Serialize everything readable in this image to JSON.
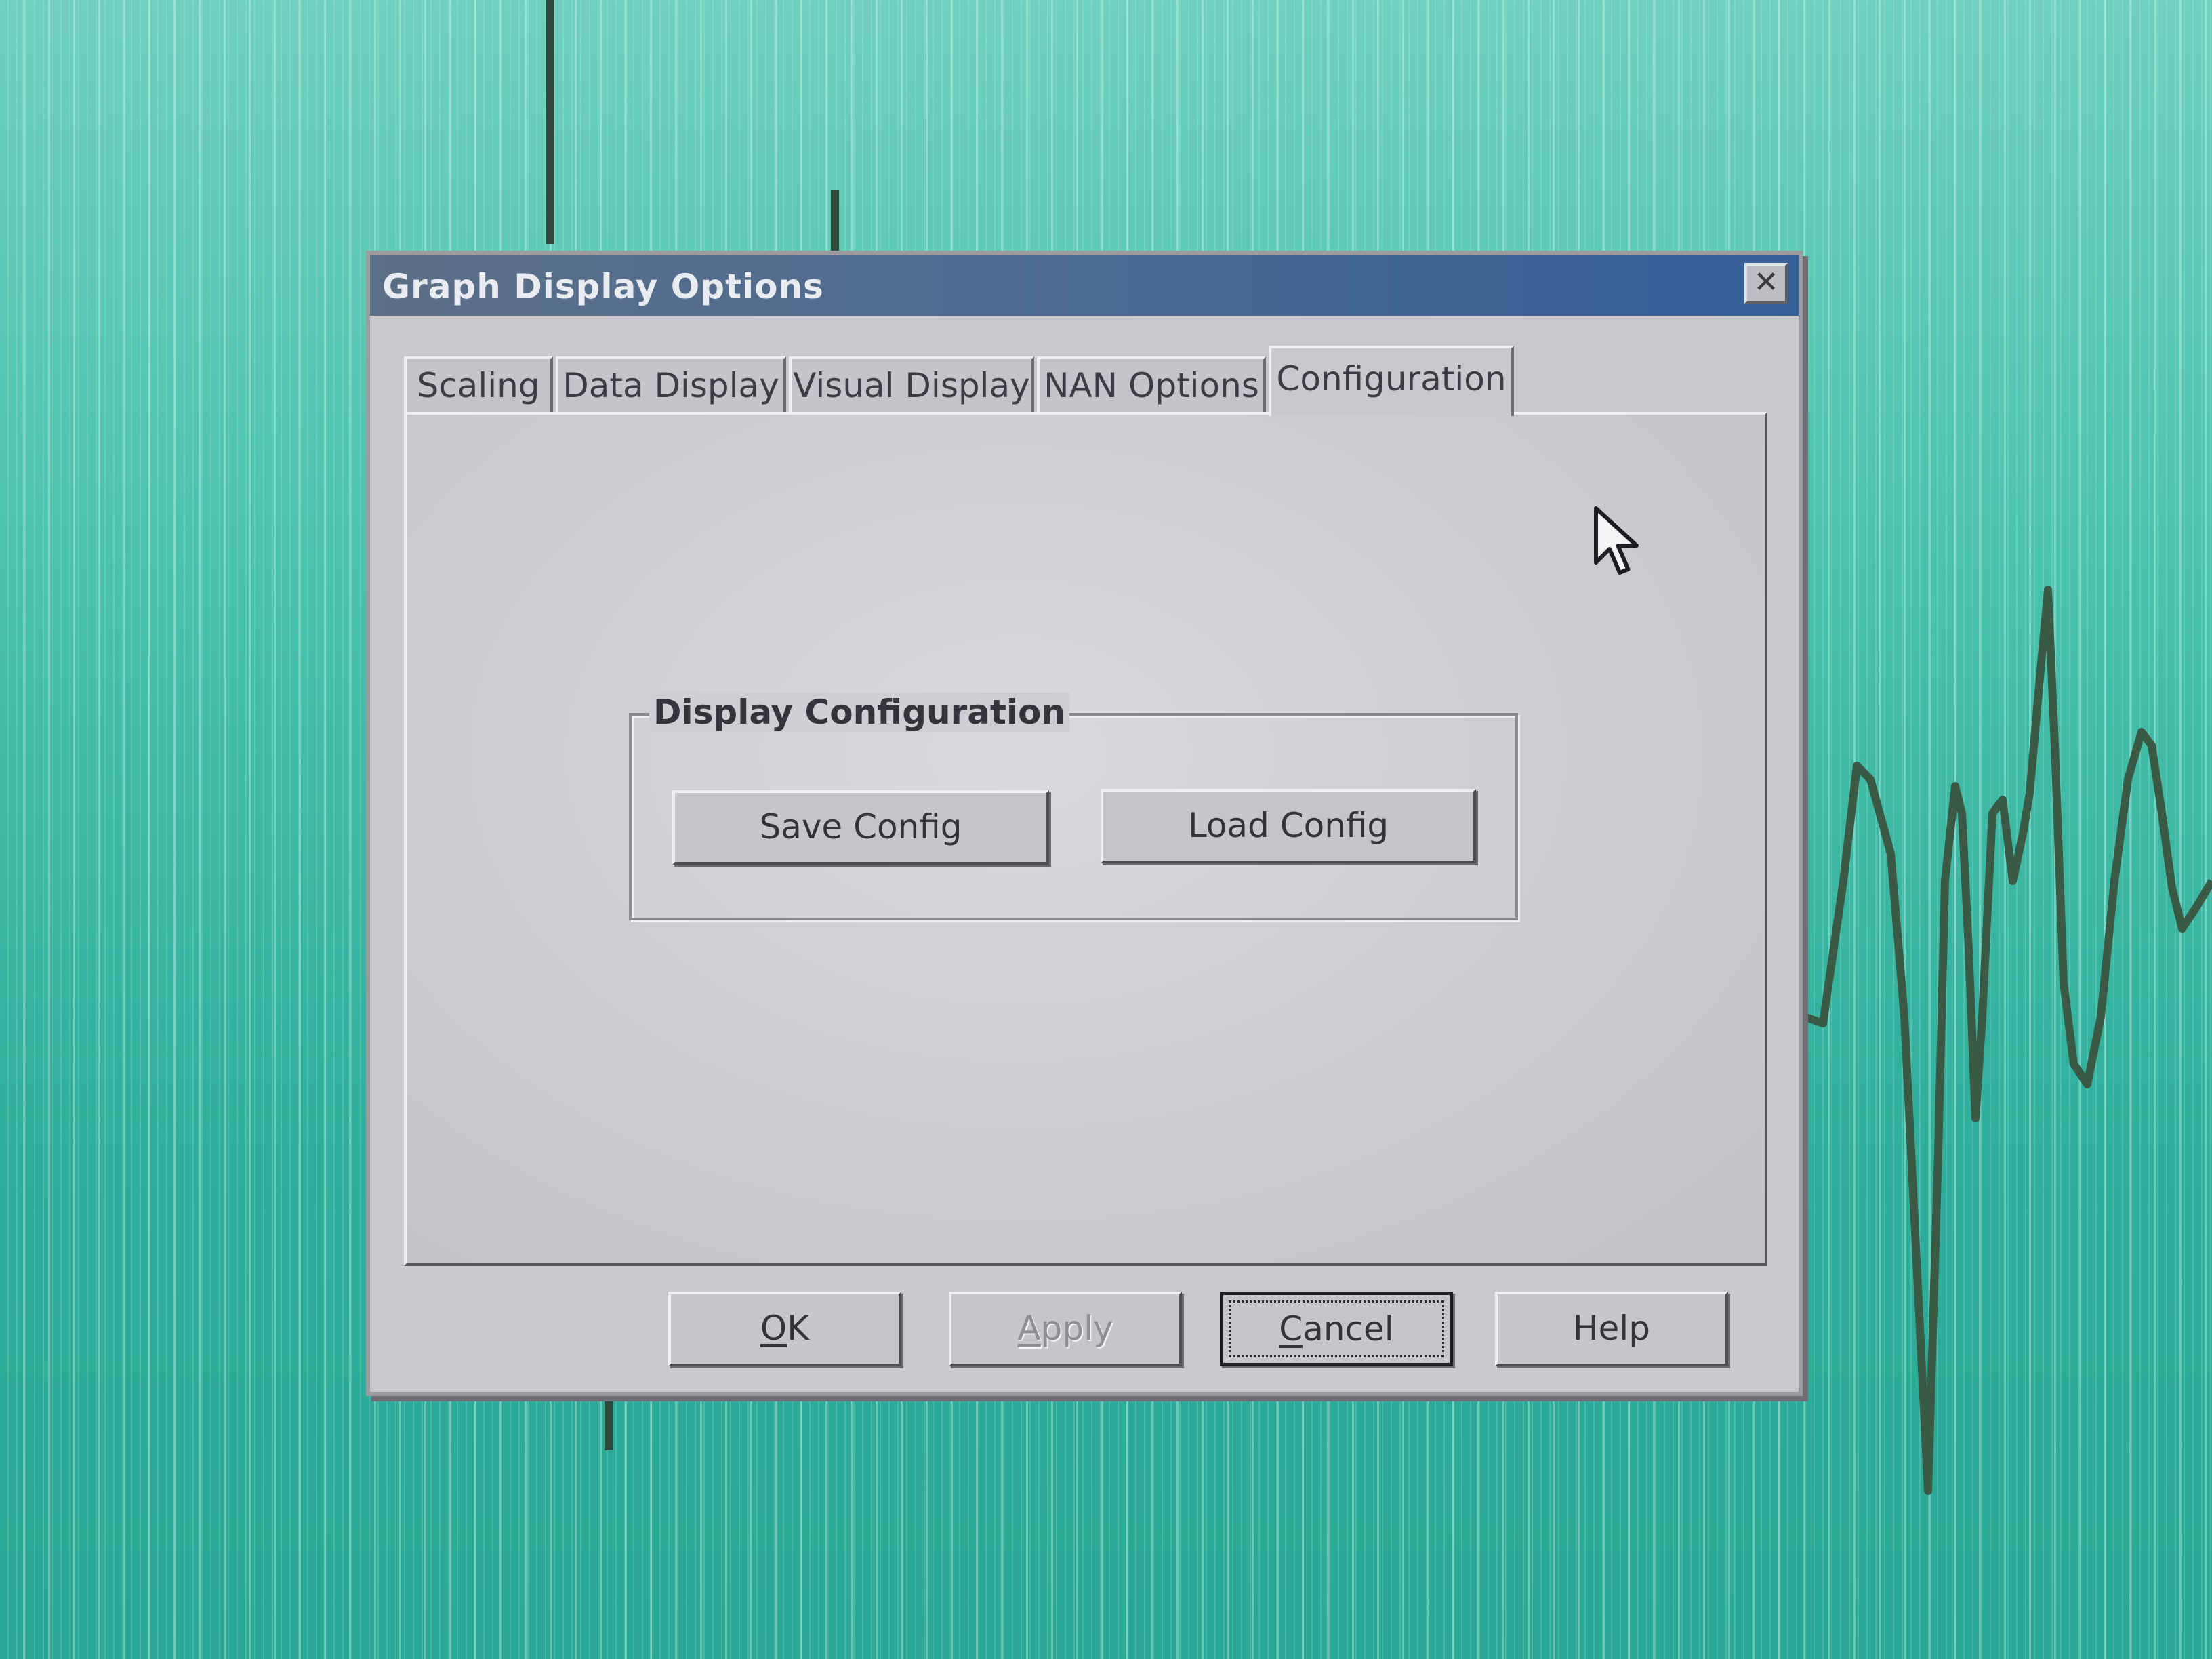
{
  "dialog": {
    "title": "Graph Display Options",
    "close_label": "✕"
  },
  "tabs": [
    {
      "label": "Scaling",
      "active": false
    },
    {
      "label": "Data Display",
      "active": false
    },
    {
      "label": "Visual Display",
      "active": false
    },
    {
      "label": "NAN Options",
      "active": false
    },
    {
      "label": "Configuration",
      "active": true
    }
  ],
  "group": {
    "title": "Display Configuration",
    "save_label": "Save Config",
    "load_label": "Load Config"
  },
  "footer": {
    "ok_mnemonic": "O",
    "ok_rest": "K",
    "apply_mnemonic": "A",
    "apply_rest": "pply",
    "apply_enabled": false,
    "cancel_mnemonic": "C",
    "cancel_rest": "ancel",
    "help_label": "Help"
  },
  "colors": {
    "titlebar": "#4d6b93",
    "dialog_face": "#c9c8cc",
    "background_graph": "#3fb8a6",
    "waveform": "#3a5a46"
  },
  "icons": {
    "close": "close-icon",
    "pointer": "mouse-pointer-icon"
  }
}
